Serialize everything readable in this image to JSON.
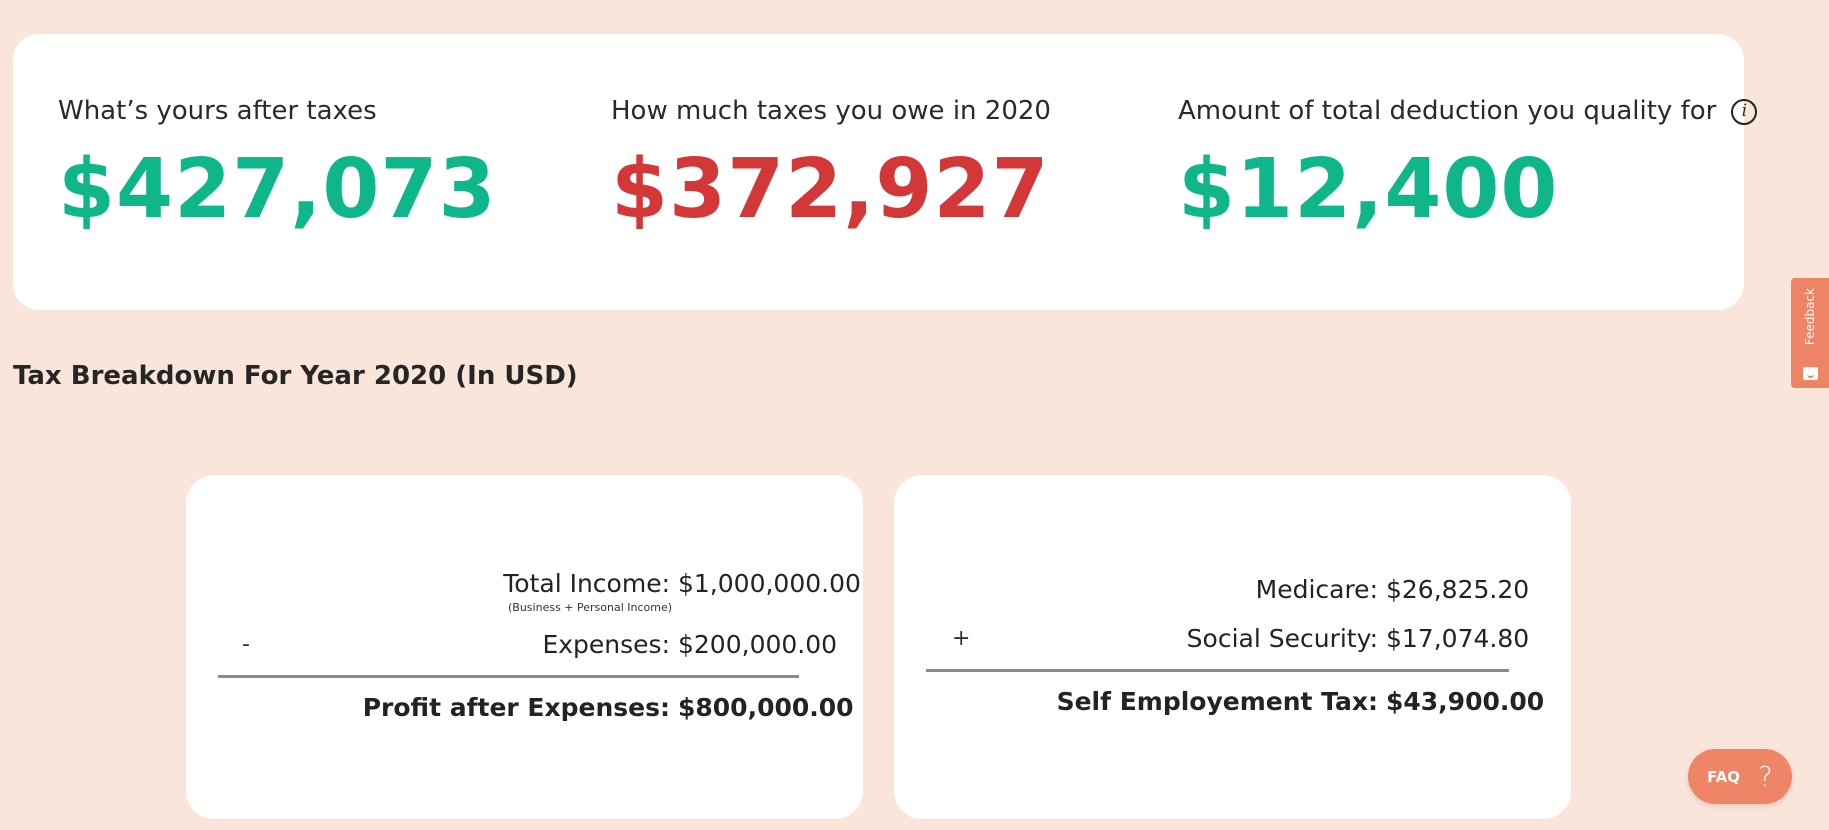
{
  "summary": {
    "after_taxes": {
      "label": "What’s yours after taxes",
      "value": "$427,073"
    },
    "taxes_owed": {
      "label": "How much taxes you owe in 2020",
      "value": "$372,927"
    },
    "deduction": {
      "label": "Amount of total deduction you quality for",
      "value": "$12,400",
      "icon": "info-icon"
    }
  },
  "section_title": "Tax Breakdown For Year 2020 (In USD)",
  "income_card": {
    "total_income_label": "Total Income:",
    "total_income_value": "$1,000,000.00",
    "total_income_note": "(Business + Personal Income)",
    "operator": "-",
    "expenses_label": "Expenses:",
    "expenses_value": "$200,000.00",
    "profit_label": "Profit after Expenses:",
    "profit_value": "$800,000.00"
  },
  "se_tax_card": {
    "medicare_label": "Medicare:",
    "medicare_value": "$26,825.20",
    "operator": "+",
    "social_security_label": "Social Security:",
    "social_security_value": "$17,074.80",
    "total_label": "Self Employement Tax:",
    "total_value": "$43,900.00"
  },
  "feedback": {
    "label": "Feedback",
    "icon": "smile-icon"
  },
  "faq": {
    "label": "FAQ",
    "icon": "?"
  },
  "colors": {
    "background": "#f9e5da",
    "green": "#0fb68a",
    "red": "#d33737",
    "accent": "#ef8466"
  }
}
